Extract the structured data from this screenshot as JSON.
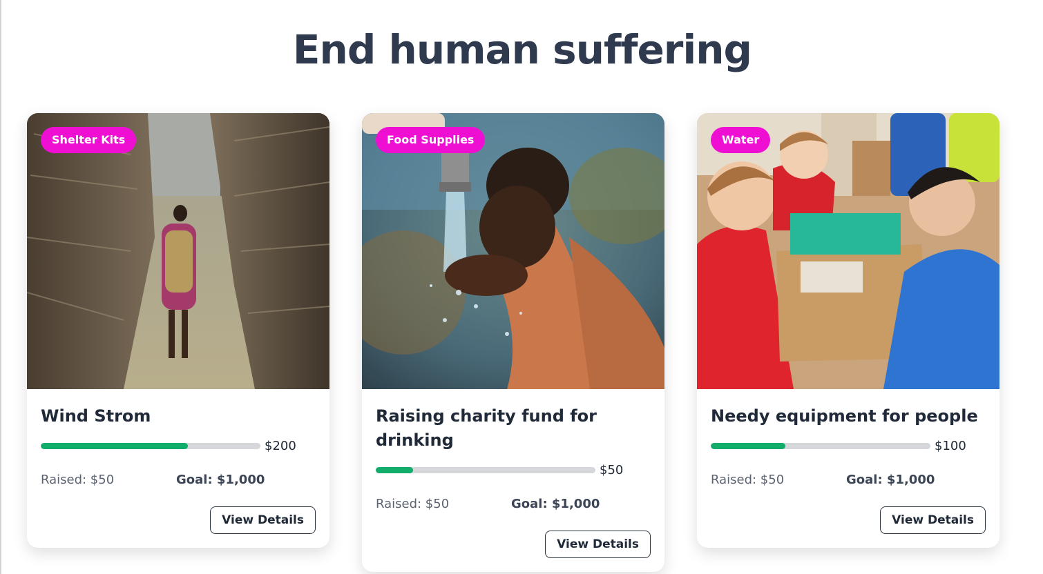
{
  "section": {
    "heading": "End human suffering"
  },
  "cards": [
    {
      "badge": "Shelter Kits",
      "title": "Wind Strom",
      "amount": "$200",
      "progress": 0.67,
      "raised": "Raised: $50",
      "goal": "Goal: $1,000",
      "button": "View Details"
    },
    {
      "badge": "Food Supplies",
      "title": "Raising charity fund for drinking",
      "amount": "$50",
      "progress": 0.17,
      "raised": "Raised: $50",
      "goal": "Goal: $1,000",
      "button": "View Details"
    },
    {
      "badge": "Water",
      "title": "Needy equipment for people",
      "amount": "$100",
      "progress": 0.34,
      "raised": "Raised: $50",
      "goal": "Goal: $1,000",
      "button": "View Details"
    }
  ],
  "colors": {
    "badge": "#ee0fd3",
    "progress_fill": "#12ad6b",
    "progress_track": "#d5d7db",
    "heading": "#2f3a4f"
  }
}
